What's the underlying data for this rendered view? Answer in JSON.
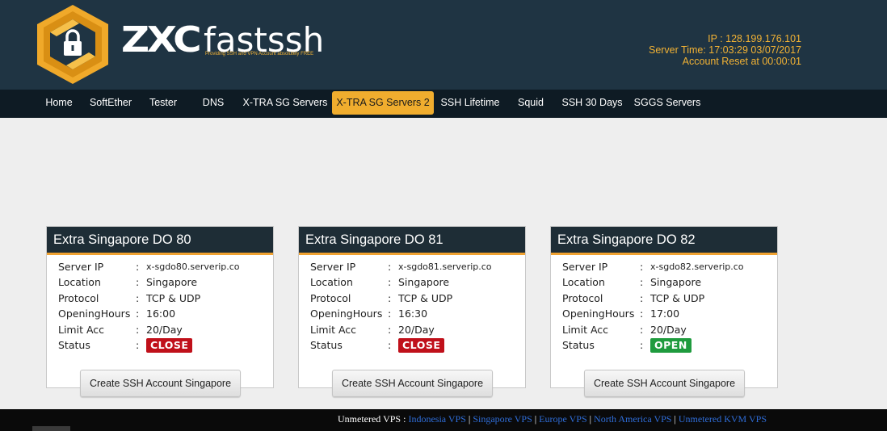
{
  "brand": {
    "logo_main": "ZXC",
    "logo_sub": "fastssh",
    "tagline": "Providing SSH and VPN Account absolutely FREE",
    "accent": "#f0ad2e",
    "header_bg": "#1f3443"
  },
  "server_info": {
    "ip": "IP : 128.199.176.101",
    "time": "Server Time: 17:03:29 03/07/2017",
    "reset": "Account Reset at 00:00:01"
  },
  "nav": {
    "items": [
      {
        "label": "Home"
      },
      {
        "label": "SoftEther"
      },
      {
        "label": "Tester"
      },
      {
        "label": "DNS"
      },
      {
        "label": "X-TRA SG Servers"
      },
      {
        "label": "X-TRA SG Servers 2",
        "active": true
      },
      {
        "label": "SSH Lifetime"
      },
      {
        "label": "Squid"
      },
      {
        "label": "SSH 30 Days"
      },
      {
        "label": "SGGS Servers"
      }
    ]
  },
  "field_labels": {
    "server_ip": "Server IP",
    "location": "Location",
    "protocol": "Protocol",
    "opening_hours": "OpeningHours",
    "limit_acc": "Limit Acc",
    "status": "Status",
    "colon": ":"
  },
  "status_colors": {
    "close": "#c0101a",
    "open": "#1f9b3e"
  },
  "cards": [
    {
      "title": "Extra Singapore DO 80",
      "server_ip": "x-sgdo80.serverip.co",
      "location": "Singapore",
      "protocol": "TCP & UDP",
      "opening_hours": "16:00",
      "limit_acc": "20/Day",
      "status": "CLOSE",
      "button": "Create SSH Account Singapore"
    },
    {
      "title": "Extra Singapore DO 81",
      "server_ip": "x-sgdo81.serverip.co",
      "location": "Singapore",
      "protocol": "TCP & UDP",
      "opening_hours": "16:30",
      "limit_acc": "20/Day",
      "status": "CLOSE",
      "button": "Create SSH Account Singapore"
    },
    {
      "title": "Extra Singapore DO 82",
      "server_ip": "x-sgdo82.serverip.co",
      "location": "Singapore",
      "protocol": "TCP & UDP",
      "opening_hours": "17:00",
      "limit_acc": "20/Day",
      "status": "OPEN",
      "button": "Create SSH Account Singapore"
    }
  ],
  "footer": {
    "prefix": "Unmetered VPS : ",
    "separator": "|",
    "links": [
      "Indonesia VPS",
      "Singapore VPS",
      "Europe VPS",
      "North America VPS",
      "Unmetered KVM VPS"
    ]
  }
}
